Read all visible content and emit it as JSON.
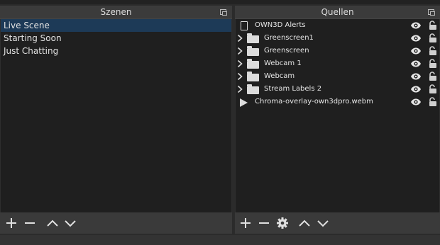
{
  "scenes": {
    "title": "Szenen",
    "items": [
      {
        "label": "Live Scene",
        "selected": true
      },
      {
        "label": "Starting Soon",
        "selected": false
      },
      {
        "label": "Just Chatting",
        "selected": false
      }
    ],
    "toolbar": [
      "plus-icon",
      "minus-icon",
      "chevron-up-icon",
      "chevron-down-icon"
    ]
  },
  "sources": {
    "title": "Quellen",
    "items": [
      {
        "label": "OWN3D Alerts",
        "type": "file",
        "expandable": false
      },
      {
        "label": "Greenscreen1",
        "type": "folder",
        "expandable": true
      },
      {
        "label": "Greenscreen",
        "type": "folder",
        "expandable": true
      },
      {
        "label": "Webcam 1",
        "type": "folder",
        "expandable": true
      },
      {
        "label": "Webcam",
        "type": "folder",
        "expandable": true
      },
      {
        "label": "Stream Labels 2",
        "type": "folder",
        "expandable": true
      },
      {
        "label": "Chroma-overlay-own3dpro.webm",
        "type": "media",
        "expandable": false
      }
    ],
    "toolbar": [
      "plus-icon",
      "minus-icon",
      "gear-icon",
      "chevron-up-icon",
      "chevron-down-icon"
    ]
  },
  "colors": {
    "selection": "#1d3a57",
    "list_bg": "#1f1f1f",
    "panel_bg": "#2e2e2e"
  }
}
